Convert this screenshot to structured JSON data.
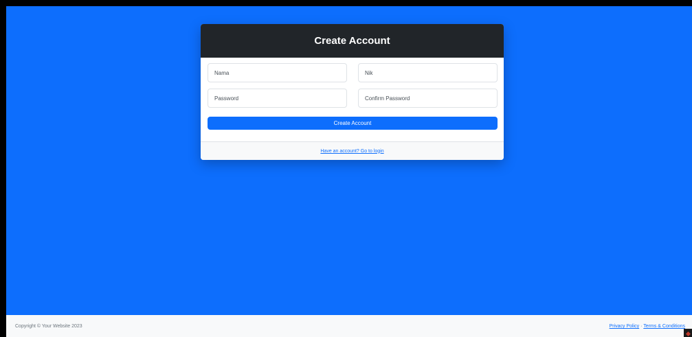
{
  "card": {
    "title": "Create Account",
    "fields": {
      "nama_placeholder": "Nama",
      "nik_placeholder": "Nik",
      "password_placeholder": "Password",
      "confirm_placeholder": "Confirm Password"
    },
    "submit_label": "Create Account",
    "login_link": "Have an account? Go to login"
  },
  "footer": {
    "copyright": "Copyright © Your Website 2023",
    "privacy": "Privacy Policy",
    "separator": "·",
    "terms": "Terms & Conditions"
  },
  "colors": {
    "background": "#0d6efd",
    "header": "#212529",
    "button": "#0d6efd"
  }
}
